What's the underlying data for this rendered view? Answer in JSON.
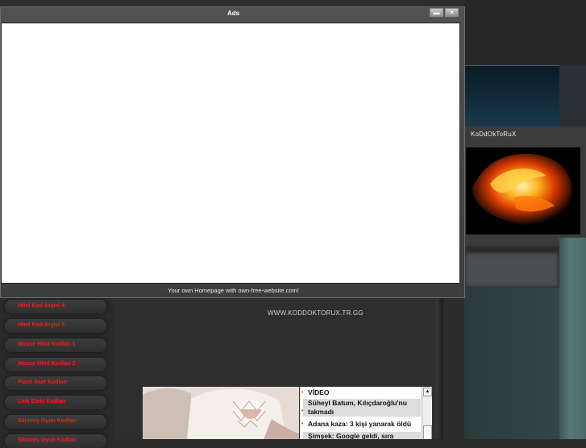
{
  "ads_window": {
    "title": "Ads",
    "footer": "Your own Homepage with own-free-website.com!",
    "minimize_glyph": "▬",
    "close_glyph": "✕"
  },
  "profile": {
    "name": "KoDdOkToRuX"
  },
  "site": {
    "url": "WWW.KODDOKTORUX.TR.GG"
  },
  "menu": {
    "items": [
      "Html Kod Arşivi 4",
      "Html Kod Arşivi 5",
      "Mouse Html Kodları 1",
      "Mouse Html Kodları 2",
      "Flash Saat Kodları",
      "Link Efekt Kodları",
      "Silinmiş Oyun Kodları",
      "Silinmiş Oyun Kodları"
    ]
  },
  "news": {
    "items": [
      "VİDEO",
      "Süheyl Batum, Kılıçdaroğlu'nu takmadı",
      "Adana kaza: 3 kişi yanarak öldü",
      "Şimşek: Google geldi, sıra"
    ],
    "scroll_up_glyph": "▲"
  },
  "colors": {
    "menu_text": "#ff1a1a",
    "bullet": "#ff3b00"
  }
}
